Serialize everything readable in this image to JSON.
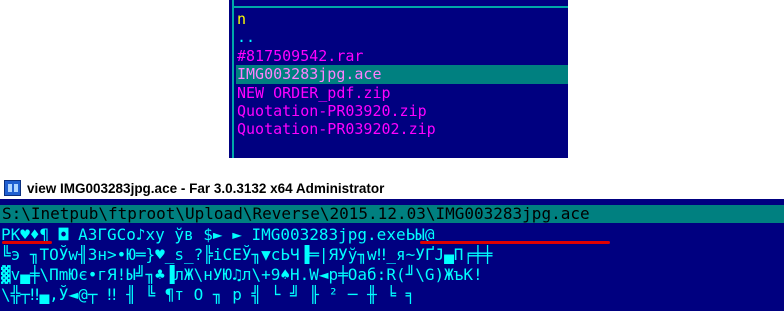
{
  "file_panel": {
    "column_title": "n",
    "items": [
      {
        "name": "..",
        "selected": false
      },
      {
        "name": "#817509542.rar",
        "selected": false
      },
      {
        "name": "IMG003283jpg.ace",
        "selected": true
      },
      {
        "name": "NEW ORDER_pdf.zip",
        "selected": false
      },
      {
        "name": "Quotation-PR03920.zip",
        "selected": false
      },
      {
        "name": "Quotation-PR039202.zip",
        "selected": false
      }
    ]
  },
  "viewer": {
    "title": "view IMG003283jpg.ace - Far 3.0.3132 x64 Administrator",
    "path": "S:\\Inetpub\\ftproot\\Upload\\Reverse\\2015.12.03\\IMG003283jpg.ace",
    "content_lines": [
      "PK♥♦¶   ◘ АЗГGСо♪ху ўв   $► ►   IMG003283jpg.exeЬЫ@",
      "╚э ╖ТОЎw╢Зн>•Ю═}♥_s_?╠iСЕЎ╖▼сЬЧ▐═|ЯУў╖w‼_я~УҐЈ▄П╒╪╪",
      "▓v▄╪\\ПmЮє•гЯ!Ы╝╖♣▐лЖ\\нУЮ♫л\\+9♠Н.W◄р╪Оаб:R(╜\\G)ЖъК!",
      "\\╬┬‼▄,Ў◄@┬ ‼ ╢ ╚ ¶т О ╖ р ╣ └ ╝ ╟ ² ─ ╫ ╘ ╕"
    ],
    "colors": {
      "background": "#000080",
      "path_bar": "#008080",
      "text": "#00ffff",
      "annotation": "#e00000"
    }
  }
}
